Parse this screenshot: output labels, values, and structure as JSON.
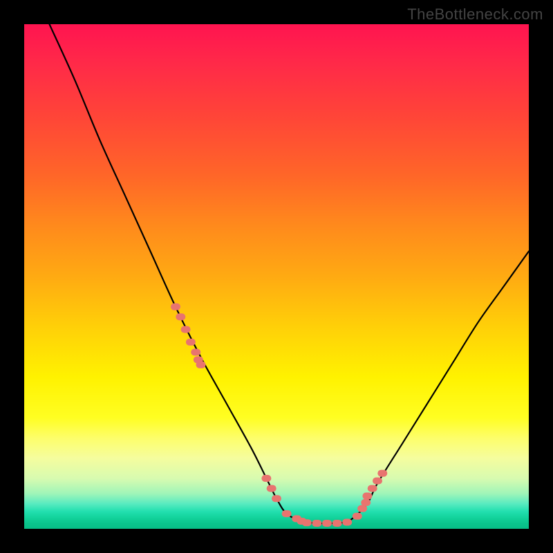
{
  "watermark": "TheBottleneck.com",
  "chart_data": {
    "type": "line",
    "title": "",
    "xlabel": "",
    "ylabel": "",
    "xlim": [
      0,
      100
    ],
    "ylim": [
      0,
      100
    ],
    "series": [
      {
        "name": "bottleneck-curve",
        "x": [
          5,
          10,
          15,
          20,
          25,
          30,
          35,
          40,
          45,
          48,
          50,
          52,
          55,
          58,
          60,
          63,
          65,
          68,
          70,
          75,
          80,
          85,
          90,
          95,
          100
        ],
        "values": [
          100,
          89,
          77,
          66,
          55,
          44,
          34,
          25,
          16,
          10,
          6,
          3,
          1.5,
          1.1,
          1.1,
          1.2,
          2,
          5,
          9,
          17,
          25,
          33,
          41,
          48,
          55
        ]
      }
    ],
    "markers": {
      "name": "highlight-dots",
      "color": "#e8746f",
      "points_x": [
        30,
        31,
        32,
        33,
        34,
        34.5,
        35,
        48,
        49,
        50,
        52,
        54,
        55,
        56,
        58,
        60,
        62,
        64,
        66,
        67,
        67.7,
        68,
        69,
        70,
        71
      ],
      "points_value": [
        44,
        42,
        39.5,
        37,
        35,
        33.5,
        32.5,
        10,
        8,
        6,
        3,
        2,
        1.5,
        1.2,
        1.1,
        1.1,
        1.1,
        1.3,
        2.5,
        4,
        5.2,
        6.5,
        8,
        9.5,
        11
      ]
    }
  }
}
